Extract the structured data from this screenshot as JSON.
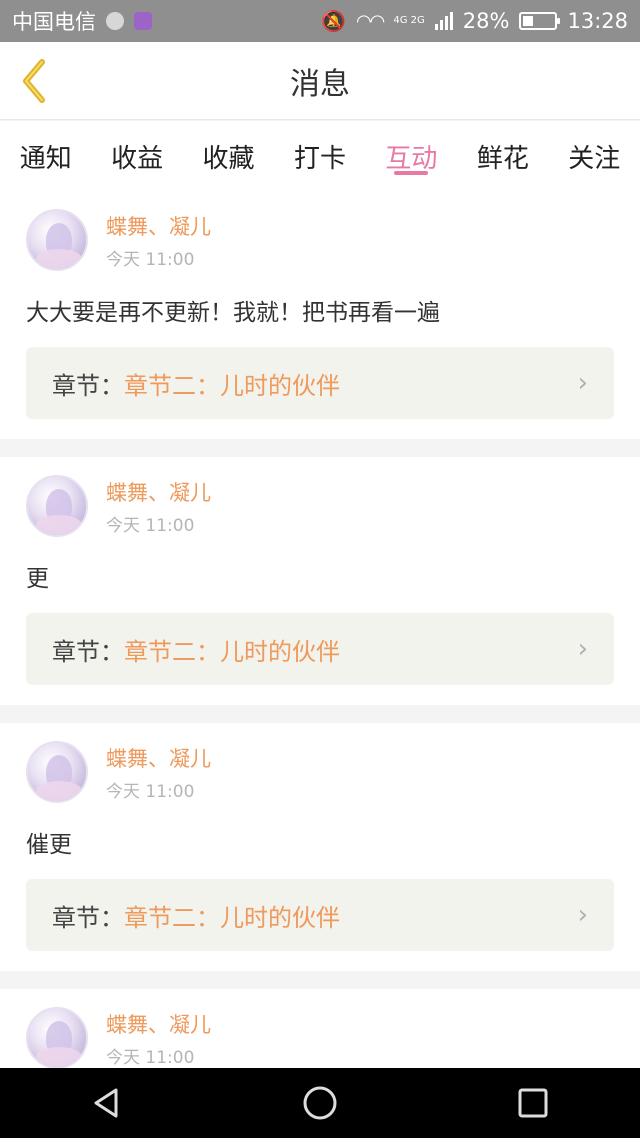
{
  "status_bar": {
    "carrier": "中国电信",
    "network": "4G 2G",
    "battery": "28%",
    "time": "13:28"
  },
  "header": {
    "title": "消息"
  },
  "tabs": [
    {
      "label": "通知"
    },
    {
      "label": "收益"
    },
    {
      "label": "收藏"
    },
    {
      "label": "打卡"
    },
    {
      "label": "互动"
    },
    {
      "label": "鲜花"
    },
    {
      "label": "关注"
    }
  ],
  "active_tab": "互动",
  "chapter_label": "章节：",
  "items": [
    {
      "name": "蝶舞、凝儿",
      "time": "今天 11:00",
      "comment": "大大要是再不更新！我就！把书再看一遍",
      "chapter": "章节二：儿时的伙伴"
    },
    {
      "name": "蝶舞、凝儿",
      "time": "今天 11:00",
      "comment": "更",
      "chapter": "章节二：儿时的伙伴"
    },
    {
      "name": "蝶舞、凝儿",
      "time": "今天 11:00",
      "comment": "催更",
      "chapter": "章节二：儿时的伙伴"
    },
    {
      "name": "蝶舞、凝儿",
      "time": "今天 11:00",
      "comment": "",
      "chapter": ""
    }
  ],
  "colors": {
    "accent": "#e879a4",
    "name": "#ee9a5c",
    "back_icon": "#f0c431"
  }
}
